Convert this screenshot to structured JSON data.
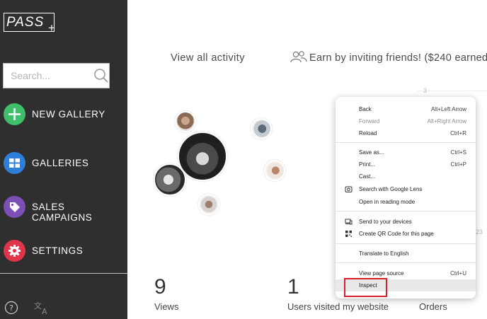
{
  "brand": {
    "logo_text": "PASS",
    "logo_plus": "+"
  },
  "search": {
    "placeholder": "Search..."
  },
  "nav": {
    "new_gallery": {
      "label": "NEW GALLERY",
      "icon": "plus-icon",
      "color": "#3fbf6b"
    },
    "galleries": {
      "label": "GALLERIES",
      "icon": "grid-icon",
      "color": "#2f7ed8"
    },
    "sales_campaigns": {
      "label": "SALES CAMPAIGNS",
      "icon": "tag-icon",
      "color": "#7c4fb6"
    },
    "settings": {
      "label": "SETTINGS",
      "icon": "gear-icon",
      "color": "#e0344a"
    }
  },
  "main": {
    "view_all_activity": "View all activity",
    "invite_text": "Earn by inviting friends! ($240 earned)"
  },
  "stats": {
    "views": {
      "value": "9",
      "label": "Views"
    },
    "users": {
      "value": "1",
      "label": "Users visited my website"
    },
    "orders": {
      "label": "Orders"
    }
  },
  "chart_ticks": {
    "top": "3",
    "bottom": "23"
  },
  "context_menu": {
    "group1": [
      {
        "label": "Back",
        "shortcut": "Alt+Left Arrow",
        "disabled": false
      },
      {
        "label": "Forward",
        "shortcut": "Alt+Right Arrow",
        "disabled": true
      },
      {
        "label": "Reload",
        "shortcut": "Ctrl+R",
        "disabled": false
      }
    ],
    "group2": [
      {
        "label": "Save as...",
        "shortcut": "Ctrl+S"
      },
      {
        "label": "Print...",
        "shortcut": "Ctrl+P"
      },
      {
        "label": "Cast...",
        "shortcut": ""
      },
      {
        "label": "Search with Google Lens",
        "shortcut": ""
      },
      {
        "label": "Open in reading mode",
        "shortcut": ""
      }
    ],
    "group3": [
      {
        "label": "Send to your devices",
        "shortcut": ""
      },
      {
        "label": "Create QR Code for this page",
        "shortcut": ""
      }
    ],
    "group4": [
      {
        "label": "Translate to English",
        "shortcut": ""
      }
    ],
    "group5": [
      {
        "label": "View page source",
        "shortcut": "Ctrl+U"
      },
      {
        "label": "Inspect",
        "shortcut": ""
      }
    ]
  },
  "colors": {
    "sidebar": "#2f2f2f",
    "highlight_box": "#d3202a"
  }
}
